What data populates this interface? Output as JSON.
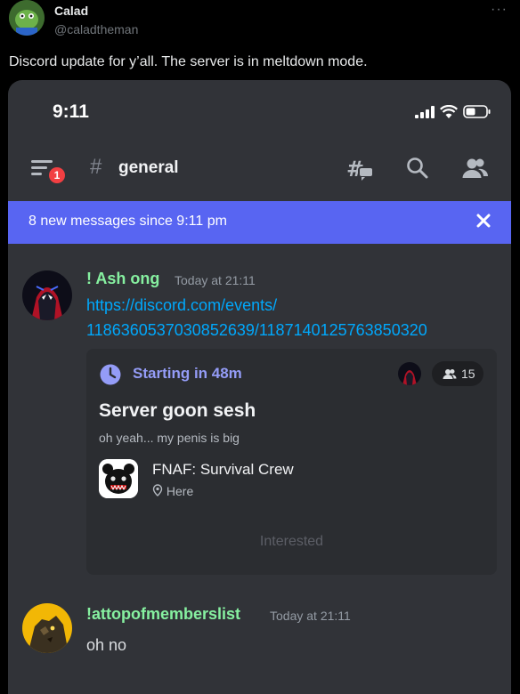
{
  "tweet": {
    "display_name": "Calad",
    "handle": "@caladtheman",
    "more_icon": "more-dots-icon",
    "text": "Discord update for y’all. The server is in meltdown mode."
  },
  "phone": {
    "time": "9:11"
  },
  "discord": {
    "unread_badge": "1",
    "channel_hash": "#",
    "channel": "general",
    "banner": {
      "text": "8 new messages since 9:11 pm"
    },
    "messages": [
      {
        "author": "! Ash ong",
        "author_color": "#86f0a0",
        "timestamp": "Today at 21:11",
        "link_line1": "https://discord.com/events/",
        "link_line2": "1186360537030852639/1187140125763850320"
      },
      {
        "author": "!attopofmemberslist",
        "author_color": "#86f0a0",
        "timestamp": "Today at 21:11",
        "text": "oh no"
      }
    ],
    "event": {
      "starting": "Starting in 48m",
      "attendees": "15",
      "title": "Server goon sesh",
      "description": "oh yeah... my penis is big",
      "server_name": "FNAF: Survival Crew",
      "location": "Here",
      "button": "Interested"
    }
  },
  "colors": {
    "accent": "#5865f2",
    "link": "#00a8fc",
    "event_accent": "#949cf7",
    "badge_red": "#f23f42"
  }
}
